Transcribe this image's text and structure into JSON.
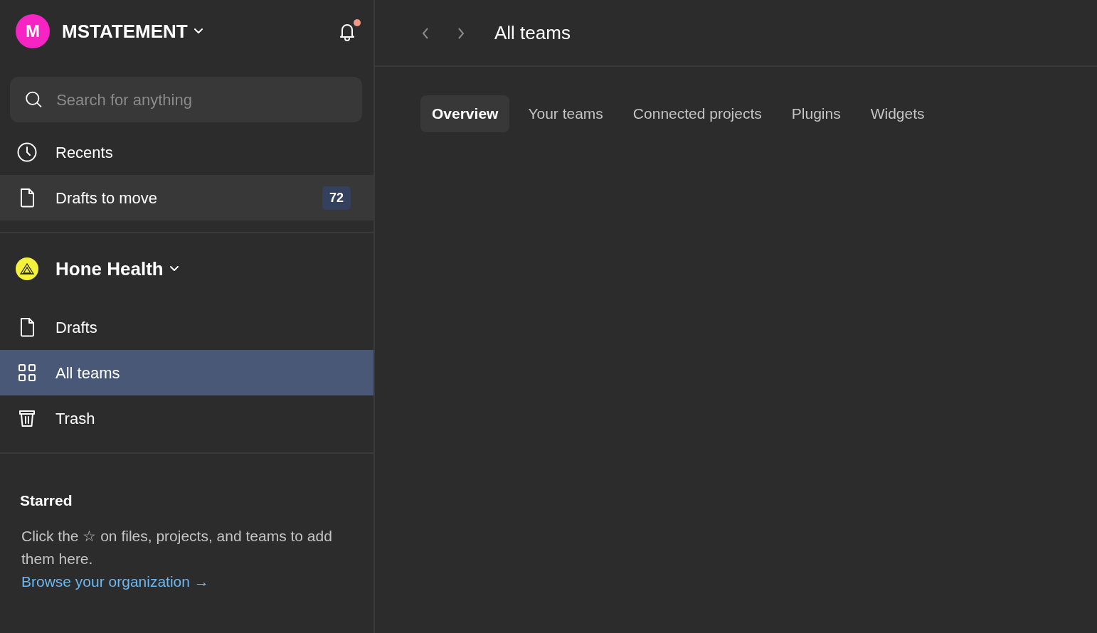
{
  "account": {
    "avatar_letter": "M",
    "name": "MSTATEMENT",
    "has_notification": true
  },
  "search": {
    "placeholder": "Search for anything"
  },
  "top_items": [
    {
      "label": "Recents",
      "highlighted": false,
      "selected": false
    },
    {
      "label": "Drafts to move",
      "count": "72",
      "highlighted": true,
      "selected": false
    }
  ],
  "organization": {
    "name": "Hone Health"
  },
  "org_items": [
    {
      "label": "Drafts",
      "selected": false
    },
    {
      "label": "All teams",
      "selected": true
    },
    {
      "label": "Trash",
      "selected": false
    }
  ],
  "starred": {
    "title": "Starred",
    "text": "Click the ☆ on files, projects, and teams to add them here.",
    "link": "Browse your organization →"
  },
  "page": {
    "title": "All teams"
  },
  "tabs": [
    {
      "label": "Overview",
      "selected": true
    },
    {
      "label": "Your teams",
      "selected": false
    },
    {
      "label": "Connected projects",
      "selected": false
    },
    {
      "label": "Plugins",
      "selected": false
    },
    {
      "label": "Widgets",
      "selected": false
    }
  ]
}
